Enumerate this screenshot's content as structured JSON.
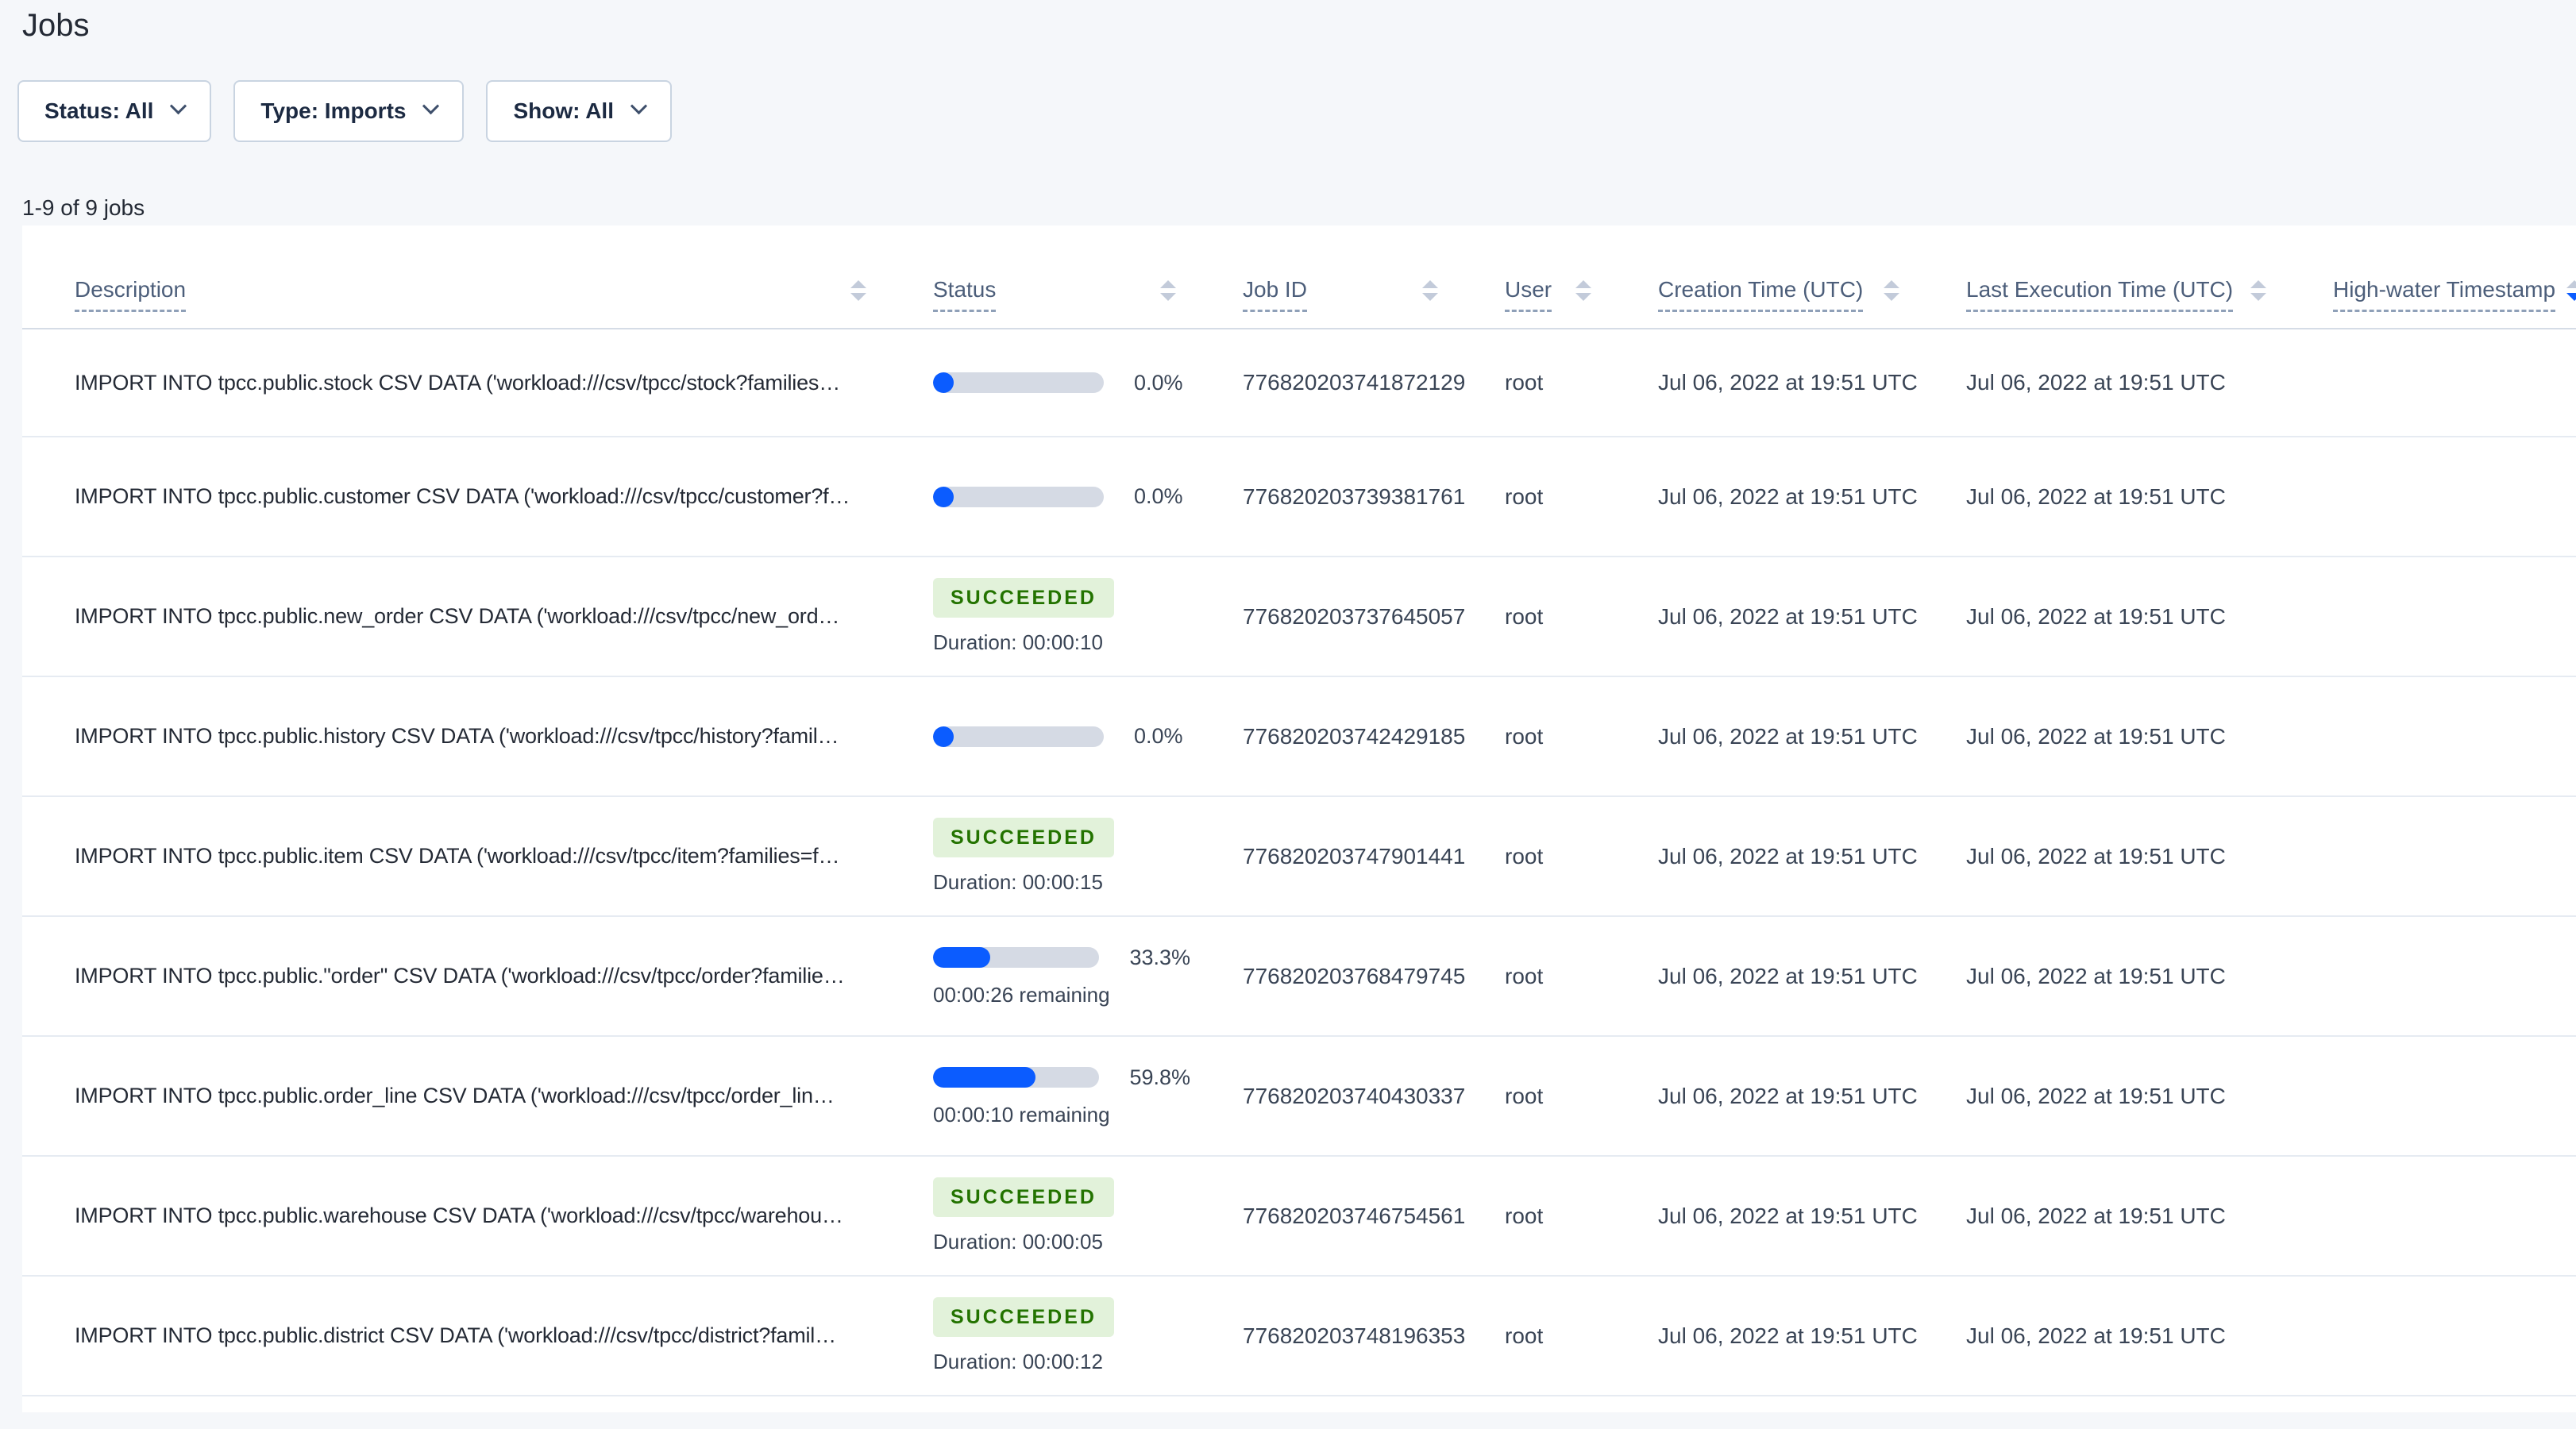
{
  "page": {
    "title": "Jobs",
    "results_count": "1-9 of 9 jobs"
  },
  "filters": {
    "status": "Status: All",
    "type": "Type: Imports",
    "show": "Show: All"
  },
  "table": {
    "columns": [
      {
        "label": "Description"
      },
      {
        "label": "Status"
      },
      {
        "label": "Job ID"
      },
      {
        "label": "User"
      },
      {
        "label": "Creation Time (UTC)"
      },
      {
        "label": "Last Execution Time (UTC)"
      },
      {
        "label": "High-water Timestamp",
        "sorted": "desc"
      }
    ],
    "sort": {
      "column": "High-water Timestamp",
      "direction": "desc"
    },
    "rows": [
      {
        "description": "IMPORT INTO tpcc.public.stock CSV DATA ('workload:///csv/tpcc/stock?families…",
        "status": {
          "kind": "progress",
          "percent_label": "0.0%",
          "fraction": 0.0
        },
        "job_id": "776820203741872129",
        "user": "root",
        "created": "Jul 06, 2022 at 19:51 UTC",
        "last_exec": "Jul 06, 2022 at 19:51 UTC",
        "high_water": ""
      },
      {
        "description": "IMPORT INTO tpcc.public.customer CSV DATA ('workload:///csv/tpcc/customer?f…",
        "status": {
          "kind": "progress",
          "percent_label": "0.0%",
          "fraction": 0.0
        },
        "job_id": "776820203739381761",
        "user": "root",
        "created": "Jul 06, 2022 at 19:51 UTC",
        "last_exec": "Jul 06, 2022 at 19:51 UTC",
        "high_water": ""
      },
      {
        "description": "IMPORT INTO tpcc.public.new_order CSV DATA ('workload:///csv/tpcc/new_ord…",
        "status": {
          "kind": "succeeded",
          "badge": "SUCCEEDED",
          "duration": "Duration: 00:00:10"
        },
        "job_id": "776820203737645057",
        "user": "root",
        "created": "Jul 06, 2022 at 19:51 UTC",
        "last_exec": "Jul 06, 2022 at 19:51 UTC",
        "high_water": ""
      },
      {
        "description": "IMPORT INTO tpcc.public.history CSV DATA ('workload:///csv/tpcc/history?famil…",
        "status": {
          "kind": "progress",
          "percent_label": "0.0%",
          "fraction": 0.0
        },
        "job_id": "776820203742429185",
        "user": "root",
        "created": "Jul 06, 2022 at 19:51 UTC",
        "last_exec": "Jul 06, 2022 at 19:51 UTC",
        "high_water": ""
      },
      {
        "description": "IMPORT INTO tpcc.public.item CSV DATA ('workload:///csv/tpcc/item?families=f…",
        "status": {
          "kind": "succeeded",
          "badge": "SUCCEEDED",
          "duration": "Duration: 00:00:15"
        },
        "job_id": "776820203747901441",
        "user": "root",
        "created": "Jul 06, 2022 at 19:51 UTC",
        "last_exec": "Jul 06, 2022 at 19:51 UTC",
        "high_water": ""
      },
      {
        "description": "IMPORT INTO tpcc.public.\"order\" CSV DATA ('workload:///csv/tpcc/order?familie…",
        "status": {
          "kind": "progress",
          "percent_label": "33.3%",
          "fraction": 0.333,
          "remaining": "00:00:26 remaining"
        },
        "job_id": "776820203768479745",
        "user": "root",
        "created": "Jul 06, 2022 at 19:51 UTC",
        "last_exec": "Jul 06, 2022 at 19:51 UTC",
        "high_water": ""
      },
      {
        "description": "IMPORT INTO tpcc.public.order_line CSV DATA ('workload:///csv/tpcc/order_lin…",
        "status": {
          "kind": "progress",
          "percent_label": "59.8%",
          "fraction": 0.598,
          "remaining": "00:00:10 remaining"
        },
        "job_id": "776820203740430337",
        "user": "root",
        "created": "Jul 06, 2022 at 19:51 UTC",
        "last_exec": "Jul 06, 2022 at 19:51 UTC",
        "high_water": ""
      },
      {
        "description": "IMPORT INTO tpcc.public.warehouse CSV DATA ('workload:///csv/tpcc/warehou…",
        "status": {
          "kind": "succeeded",
          "badge": "SUCCEEDED",
          "duration": "Duration: 00:00:05"
        },
        "job_id": "776820203746754561",
        "user": "root",
        "created": "Jul 06, 2022 at 19:51 UTC",
        "last_exec": "Jul 06, 2022 at 19:51 UTC",
        "high_water": ""
      },
      {
        "description": "IMPORT INTO tpcc.public.district CSV DATA ('workload:///csv/tpcc/district?famil…",
        "status": {
          "kind": "succeeded",
          "badge": "SUCCEEDED",
          "duration": "Duration: 00:00:12"
        },
        "job_id": "776820203748196353",
        "user": "root",
        "created": "Jul 06, 2022 at 19:51 UTC",
        "last_exec": "Jul 06, 2022 at 19:51 UTC",
        "high_water": ""
      }
    ]
  },
  "colors": {
    "page_bg": "#f5f7fa",
    "accent_blue": "#0b5cff",
    "progress_track": "#d5dae4",
    "success_text": "#237300",
    "success_bg": "#e2f2da"
  }
}
